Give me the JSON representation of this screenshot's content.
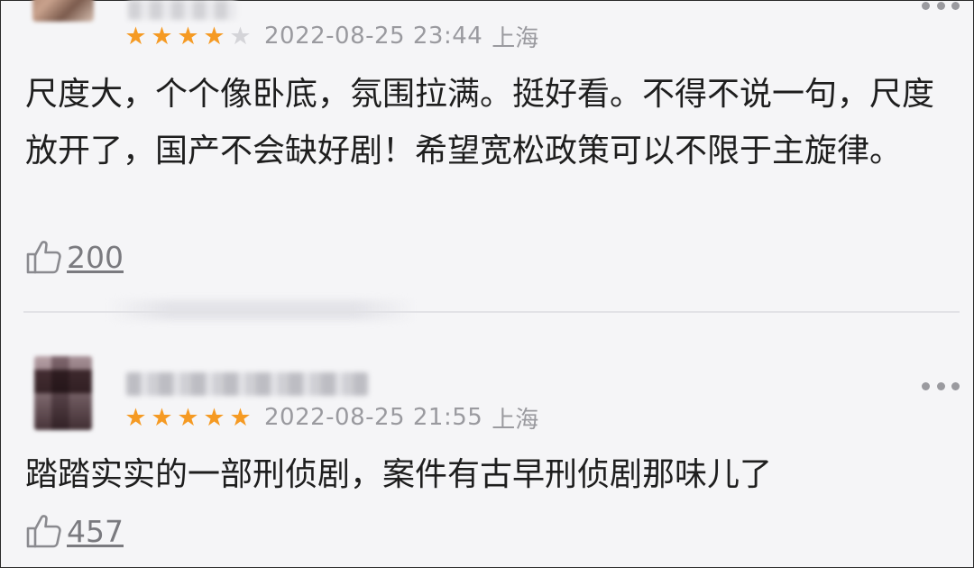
{
  "comments": [
    {
      "rating": 4,
      "max_rating": 5,
      "date": "2022-08-25 23:44",
      "location": "上海",
      "text": "尺度大，个个像卧底，氛围拉满。挺好看。不得不说一句，尺度放开了，国产不会缺好剧！希望宽松政策可以不限于主旋律。",
      "likes": "200"
    },
    {
      "rating": 5,
      "max_rating": 5,
      "date": "2022-08-25 21:55",
      "location": "上海",
      "text": "踏踏实实的一部刑侦剧，案件有古早刑侦剧那味儿了",
      "likes": "457"
    }
  ],
  "icons": {
    "star": "star-icon",
    "like": "thumbs-up-icon",
    "more": "more-icon"
  },
  "colors": {
    "star_on": "#f59a23",
    "star_off": "#d4d4d8",
    "meta_text": "#9a9a9f",
    "body_text": "#1e1e1e"
  }
}
